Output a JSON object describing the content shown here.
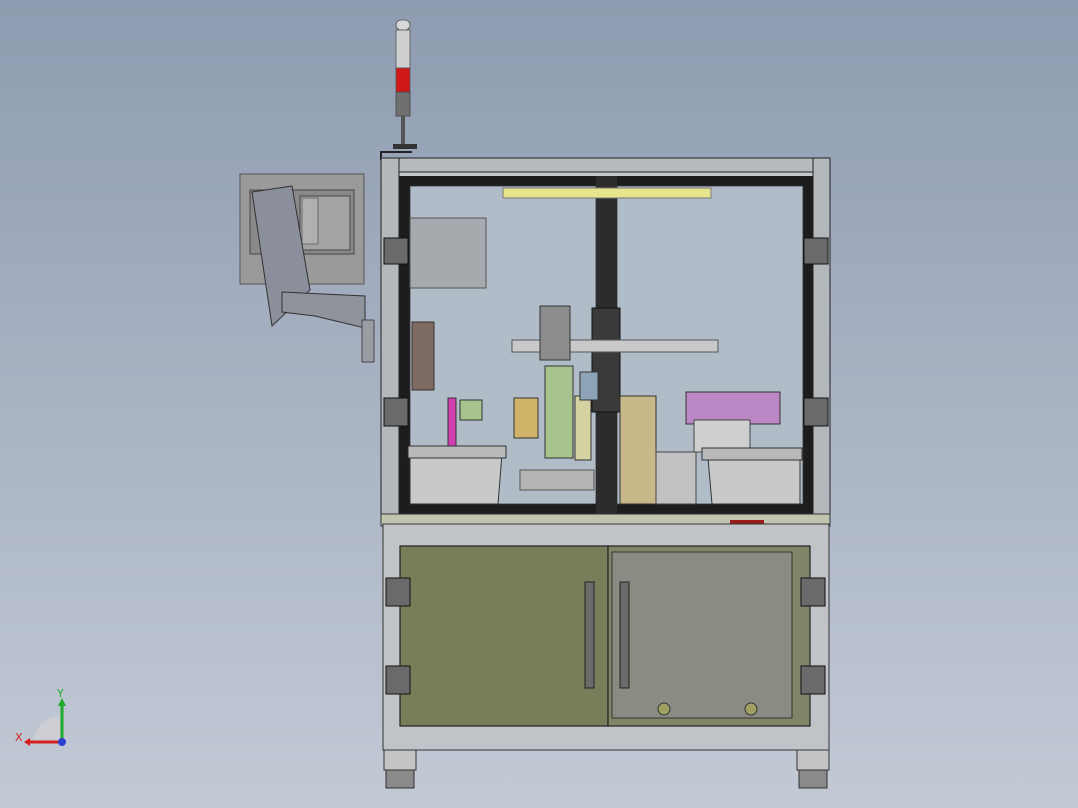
{
  "viewport": {
    "background_top": "#8e9bb0",
    "background_bottom": "#c3cad6"
  },
  "triad": {
    "x_label": "X",
    "y_label": "Y",
    "x_color": "#d42020",
    "y_color": "#1faa2a",
    "z_color": "#2a3fd0"
  },
  "machine": {
    "frame_color": "#b9bec4",
    "glass_color": "#aeb9c6",
    "lower_panel_color": "#7a7d5a",
    "signal_tower_colors": [
      "#c8c8c8",
      "#d01818",
      "#6e6e6e"
    ]
  }
}
